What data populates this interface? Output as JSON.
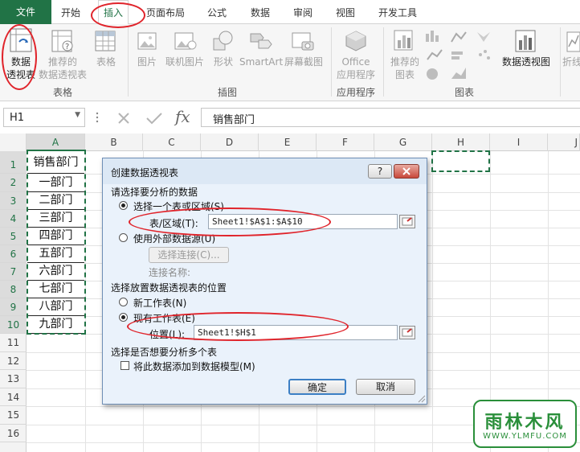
{
  "tabs": [
    "文件",
    "开始",
    "插入",
    "页面布局",
    "公式",
    "数据",
    "审阅",
    "视图",
    "开发工具"
  ],
  "ribbon": {
    "pivot_table": [
      "数据",
      "透视表"
    ],
    "recommended_pivot": [
      "推荐的",
      "数据透视表"
    ],
    "table": "表格",
    "picture": "图片",
    "online_picture": "联机图片",
    "shapes": "形状",
    "smartart": "SmartArt",
    "screenshot": "屏幕截图",
    "office_apps": [
      "Office",
      "应用程序"
    ],
    "recommended_charts": [
      "推荐的",
      "图表"
    ],
    "pivot_chart": "数据透视图",
    "sparkline": "折线",
    "groups": {
      "tables": "表格",
      "illustrations": "插图",
      "apps": "应用程序",
      "charts": "图表"
    }
  },
  "formula_bar": {
    "name_box": "H1",
    "content": "销售部门"
  },
  "sheet": {
    "columns": [
      "A",
      "B",
      "C",
      "D",
      "E",
      "F",
      "G",
      "H",
      "I",
      "J"
    ],
    "rows": [
      "1",
      "2",
      "3",
      "4",
      "5",
      "6",
      "7",
      "8",
      "9",
      "10",
      "11",
      "12",
      "13",
      "14",
      "15",
      "16"
    ],
    "column_a": [
      "销售部门",
      "一部门",
      "二部门",
      "三部门",
      "四部门",
      "五部门",
      "六部门",
      "七部门",
      "八部门",
      "九部门"
    ]
  },
  "dialog": {
    "title": "创建数据透视表",
    "help": "?",
    "section1": "请选择要分析的数据",
    "opt_range": "选择一个表或区域(S)",
    "range_label": "表/区域(T):",
    "range_value": "Sheet1!$A$1:$A$10",
    "opt_external": "使用外部数据源(U)",
    "choose_conn": "选择连接(C)...",
    "conn_name": "连接名称:",
    "section2": "选择放置数据透视表的位置",
    "opt_new": "新工作表(N)",
    "opt_existing": "现有工作表(E)",
    "location_label": "位置(L):",
    "location_value": "Sheet1!$H$1",
    "section3": "选择是否想要分析多个表",
    "add_model": "将此数据添加到数据模型(M)",
    "ok": "确定",
    "cancel": "取消"
  },
  "watermark": {
    "brand": "雨林木风",
    "url": "WWW.YLMFU.COM"
  },
  "colors": {
    "excel_green": "#217346",
    "highlight_red": "#e0242b"
  }
}
